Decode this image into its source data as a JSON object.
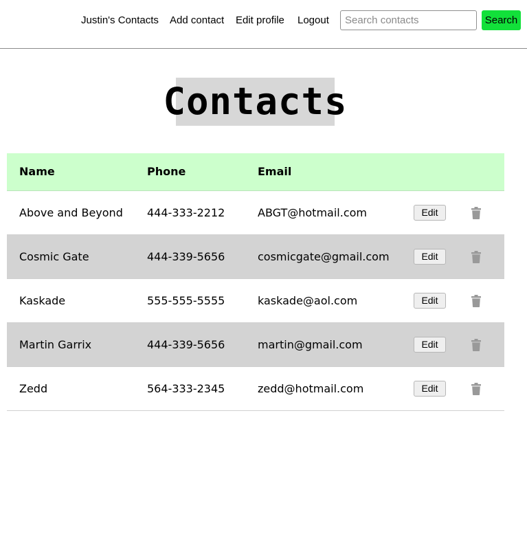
{
  "nav": {
    "brand": "Justin's Contacts",
    "links": [
      "Add contact",
      "Edit profile",
      "Logout"
    ],
    "search_placeholder": "Search contacts",
    "search_button": "Search"
  },
  "page_title": "Contacts",
  "table": {
    "headers": [
      "Name",
      "Phone",
      "Email"
    ],
    "edit_label": "Edit",
    "rows": [
      {
        "name": "Above and Beyond",
        "phone": "444-333-2212",
        "email": "ABGT@hotmail.com"
      },
      {
        "name": "Cosmic Gate",
        "phone": "444-339-5656",
        "email": "cosmicgate@gmail.com"
      },
      {
        "name": "Kaskade",
        "phone": "555-555-5555",
        "email": "kaskade@aol.com"
      },
      {
        "name": "Martin Garrix",
        "phone": "444-339-5656",
        "email": "martin@gmail.com"
      },
      {
        "name": "Zedd",
        "phone": "564-333-2345",
        "email": "zedd@hotmail.com"
      }
    ]
  },
  "icons": {
    "delete": "trash-icon"
  },
  "colors": {
    "search_button": "#12e03a",
    "header_row": "#ccffcc",
    "alt_row": "#d3d3d3",
    "title_bg": "#d7d7d7",
    "trash": "#999999"
  }
}
